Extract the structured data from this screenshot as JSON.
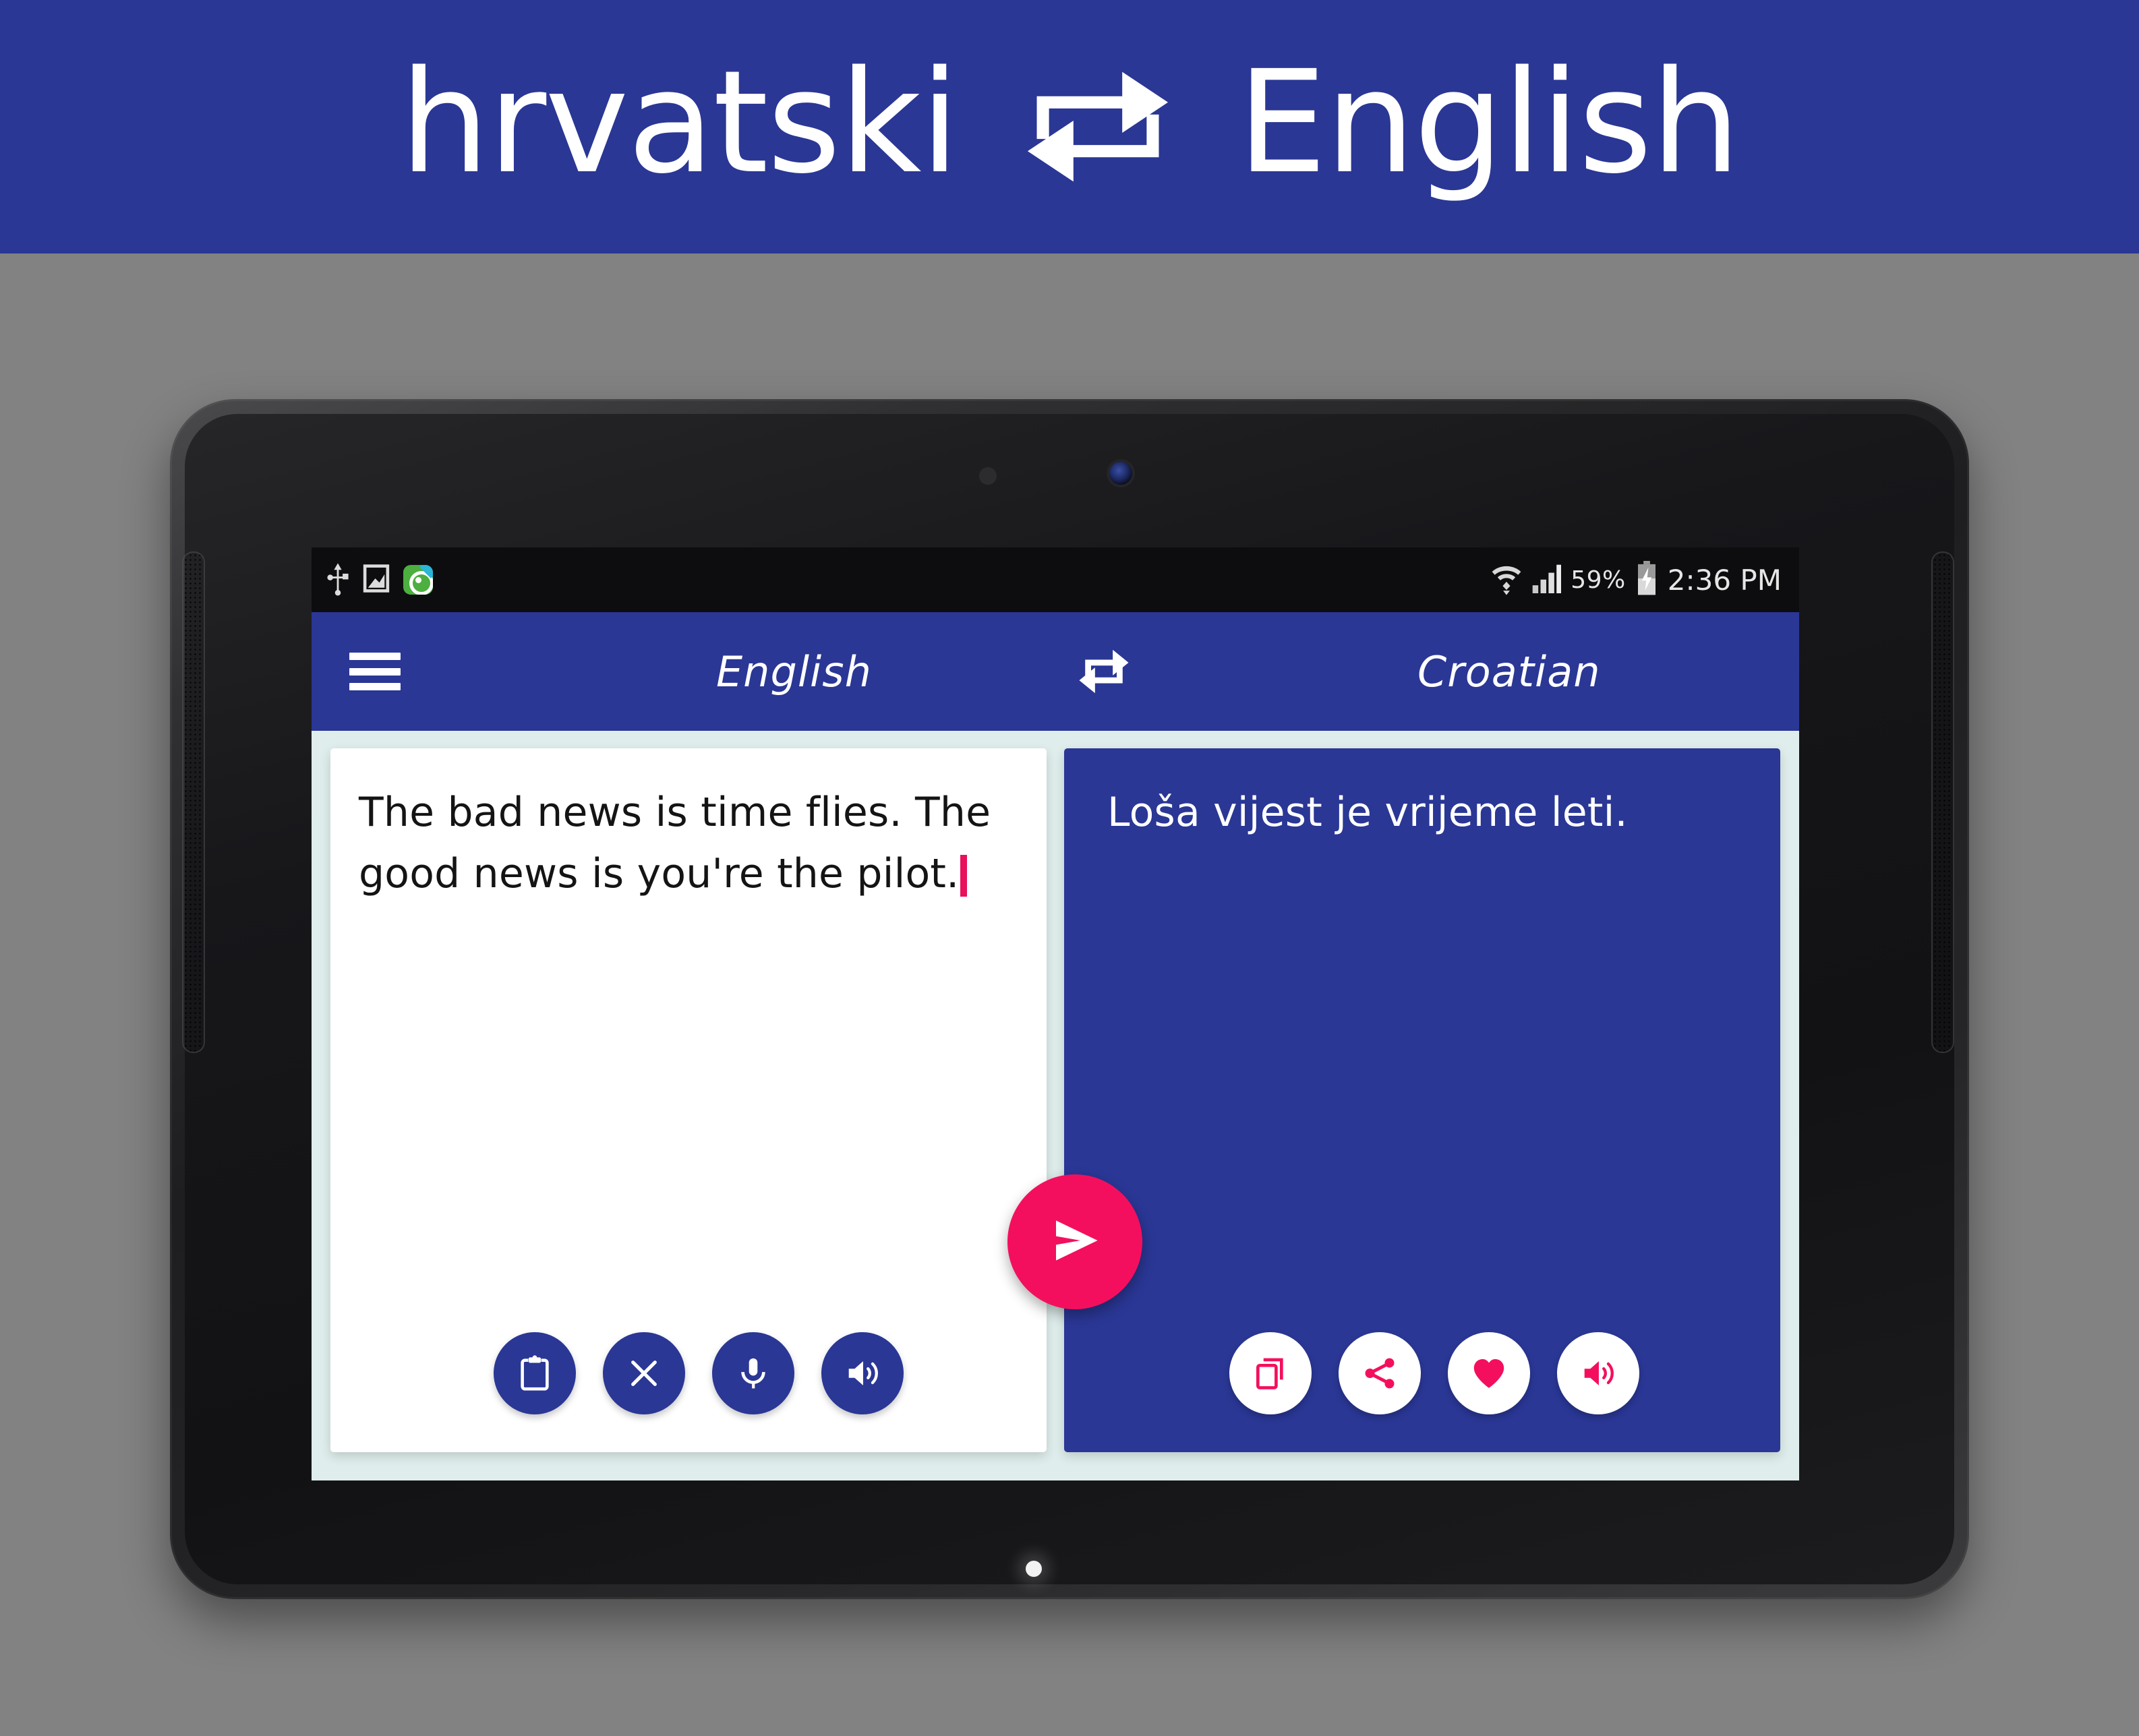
{
  "banner": {
    "left_language": "hrvatski",
    "right_language": "English",
    "swap_icon": "swap-repeat-icon",
    "background_color": "#2A3795",
    "text_color": "#FFFFFF"
  },
  "page_background_color": "#828282",
  "device": {
    "type": "android-tablet",
    "front_camera_icon": "front-camera-icon",
    "sensor_icon": "proximity-sensor-icon",
    "led_icon": "notification-led-icon",
    "speaker_icon": "speaker-grille-icon"
  },
  "status_bar": {
    "left_icons": [
      "usb-icon",
      "screenshot-icon",
      "app-notification-icon"
    ],
    "right_icons": [
      "wifi-icon",
      "signal-bars-icon",
      "battery-charging-icon"
    ],
    "battery_percent": "59%",
    "time": "2:36 PM"
  },
  "toolbar": {
    "menu_icon": "hamburger-menu-icon",
    "source_language": "English",
    "swap_icon": "swap-languages-icon",
    "target_language": "Croatian",
    "background_color": "#2A3795"
  },
  "source_panel": {
    "text": "The bad news is time flies. The good news is you're the pilot.",
    "has_caret": true,
    "caret_color": "#E8115B",
    "background_color": "#FFFFFF",
    "actions": [
      {
        "name": "paste-button",
        "icon": "clipboard-paste-icon",
        "label": "Paste"
      },
      {
        "name": "clear-button",
        "icon": "close-x-icon",
        "label": "Clear"
      },
      {
        "name": "voice-input-button",
        "icon": "microphone-icon",
        "label": "Voice input"
      },
      {
        "name": "speak-source-button",
        "icon": "speaker-volume-icon",
        "label": "Speak"
      }
    ]
  },
  "target_panel": {
    "text": "Loša vijest je vrijeme leti.",
    "background_color": "#2A3795",
    "actions": [
      {
        "name": "copy-button",
        "icon": "copy-icon",
        "label": "Copy"
      },
      {
        "name": "share-button",
        "icon": "share-icon",
        "label": "Share"
      },
      {
        "name": "favorite-button",
        "icon": "heart-icon",
        "label": "Favorite"
      },
      {
        "name": "speak-target-button",
        "icon": "speaker-volume-icon",
        "label": "Speak"
      }
    ]
  },
  "translate_button": {
    "icon": "send-arrow-icon",
    "label": "Translate",
    "color": "#F40F5E"
  },
  "app_background_color": "#DFEEEC"
}
